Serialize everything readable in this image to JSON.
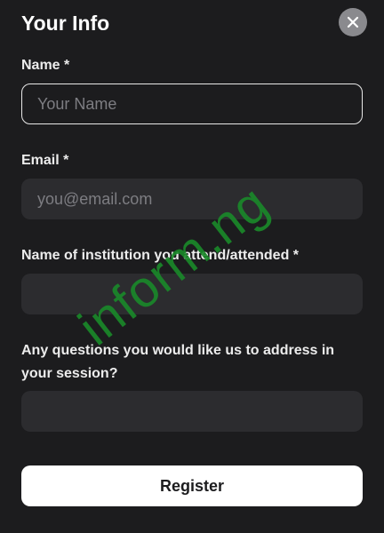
{
  "form": {
    "title": "Your Info",
    "fields": [
      {
        "label": "Name *",
        "placeholder": "Your Name",
        "value": ""
      },
      {
        "label": "Email *",
        "placeholder": "you@email.com",
        "value": ""
      },
      {
        "label": "Name of institution you attend/attended *",
        "placeholder": "",
        "value": ""
      },
      {
        "label": "Any questions you would like us to address in your session?",
        "placeholder": "",
        "value": ""
      }
    ],
    "submit_label": "Register",
    "close_icon": "close-icon"
  },
  "watermark": "inform.ng",
  "colors": {
    "background": "#1c1c1e",
    "input_bg": "#2c2c2f",
    "close_button": "#8a8a8e",
    "watermark": "#1a8a2a"
  }
}
